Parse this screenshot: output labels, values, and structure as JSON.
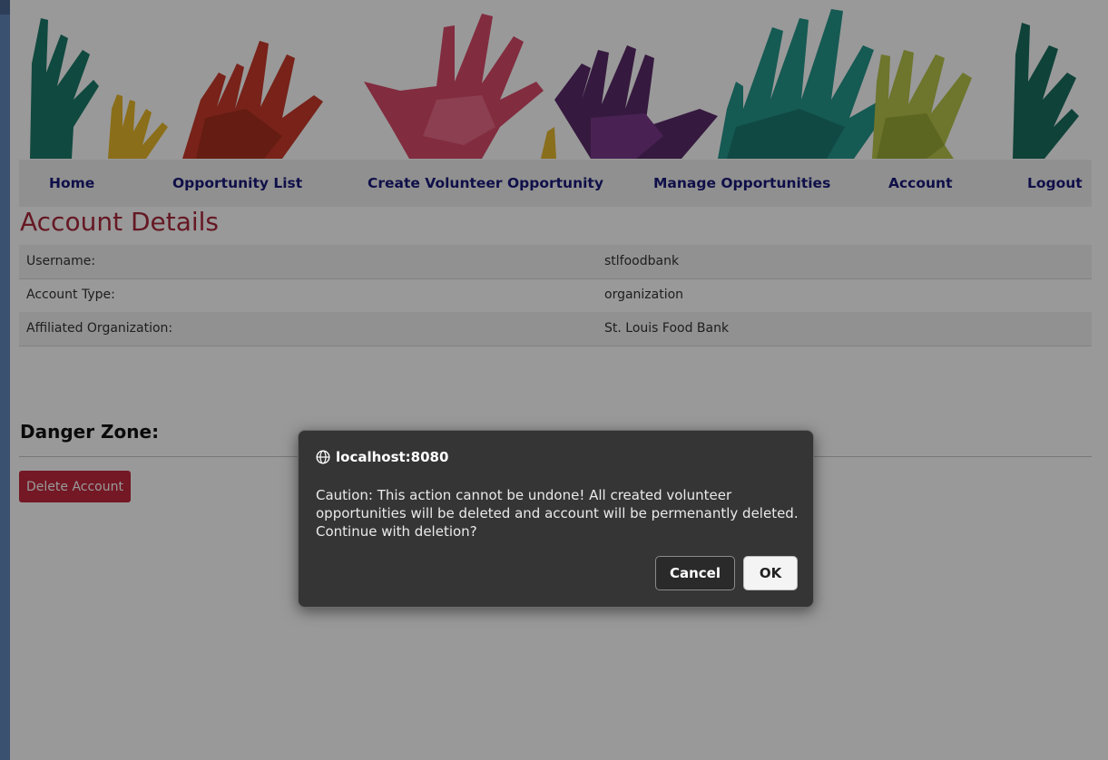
{
  "nav": {
    "home": "Home",
    "opportunity_list": "Opportunity List",
    "create_opportunity": "Create Volunteer Opportunity",
    "manage_opportunities": "Manage Opportunities",
    "account": "Account",
    "logout": "Logout"
  },
  "page": {
    "title": "Account Details",
    "details": [
      {
        "label": "Username:",
        "value": "stlfoodbank"
      },
      {
        "label": "Account Type:",
        "value": "organization"
      },
      {
        "label": "Affiliated Organization:",
        "value": "St. Louis Food Bank"
      }
    ],
    "danger_heading": "Danger Zone:",
    "delete_label": "Delete Account"
  },
  "dialog": {
    "origin": "localhost:8080",
    "message_lines": [
      "Caution: This action cannot be undone! All created volunteer",
      "opportunities will be deleted and account will be permenantly deleted.",
      "Continue with deletion?"
    ],
    "cancel_label": "Cancel",
    "ok_label": "OK"
  },
  "colors": {
    "nav_text": "#1a1a7a",
    "title": "#a8283b",
    "danger_button": "#c0283c",
    "dialog_bg": "#353535"
  },
  "icons": {
    "origin": "globe-icon"
  }
}
